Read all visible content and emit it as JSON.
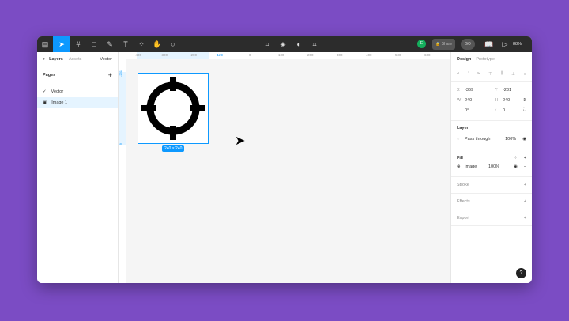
{
  "toolbar": {
    "share": "Share",
    "avatar": "GO",
    "user": "E",
    "zoom": "88%"
  },
  "left": {
    "tabs": [
      "Layers",
      "Assets"
    ],
    "page_select": "Vector",
    "pages_label": "Pages",
    "layers": [
      "Vector",
      "Image 1"
    ]
  },
  "canvas": {
    "size_label": "240 × 240",
    "h_ruler": [
      "-400",
      "-300",
      "-200",
      "-129",
      "0",
      "100",
      "200",
      "300",
      "400",
      "500",
      "600"
    ],
    "v_ruler": [
      "-231",
      "9"
    ]
  },
  "right": {
    "tabs": [
      "Design",
      "Prototype"
    ],
    "x_label": "X",
    "x": "-369",
    "y_label": "Y",
    "y": "-231",
    "w_label": "W",
    "w": "240",
    "h_label": "H",
    "h": "240",
    "rotation": "0°",
    "radius": "0",
    "layer_title": "Layer",
    "blend": "Pass through",
    "layer_opacity": "100%",
    "fill_title": "Fill",
    "fill_name": "Image",
    "fill_opacity": "100%",
    "stroke": "Stroke",
    "effects": "Effects",
    "export": "Export"
  },
  "help": "?"
}
